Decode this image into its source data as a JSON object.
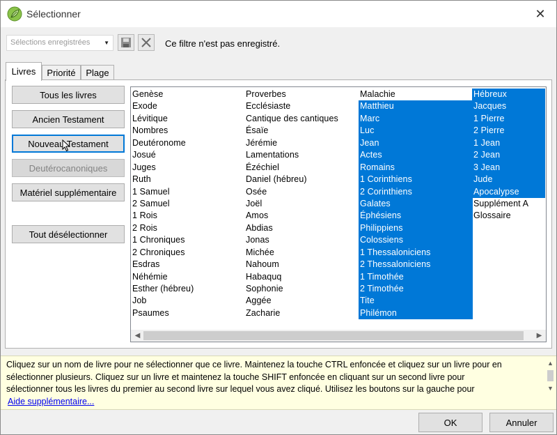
{
  "window": {
    "title": "Sélectionner"
  },
  "toolbar": {
    "saved_selections_placeholder": "Sélections enregistrées",
    "filter_status": "Ce filtre n'est pas enregistré."
  },
  "tabs": [
    {
      "label": "Livres",
      "active": true
    },
    {
      "label": "Priorité",
      "active": false
    },
    {
      "label": "Plage",
      "active": false
    }
  ],
  "side_buttons": {
    "all_books": "Tous les livres",
    "old_testament": "Ancien Testament",
    "new_testament": "Nouveau Testament",
    "deuterocanonical": "Deutérocanoniques",
    "supplementary": "Matériel supplémentaire",
    "deselect_all": "Tout désélectionner"
  },
  "books": {
    "col1": [
      "Genèse",
      "Exode",
      "Lévitique",
      "Nombres",
      "Deutéronome",
      "Josué",
      "Juges",
      "Ruth",
      "1 Samuel",
      "2 Samuel",
      "1 Rois",
      "2 Rois",
      "1 Chroniques",
      "2 Chroniques",
      "Esdras",
      "Néhémie",
      "Esther (hébreu)",
      "Job",
      "Psaumes"
    ],
    "col2": [
      "Proverbes",
      "Ecclésiaste",
      "Cantique des cantiques",
      "Ésaïe",
      "Jérémie",
      "Lamentations",
      "Ézéchiel",
      "Daniel (hébreu)",
      "Osée",
      "Joël",
      "Amos",
      "Abdias",
      "Jonas",
      "Michée",
      "Nahoum",
      "Habaquq",
      "Sophonie",
      "Aggée",
      "Zacharie"
    ],
    "col3": [
      "Malachie",
      "Matthieu",
      "Marc",
      "Luc",
      "Jean",
      "Actes",
      "Romains",
      "1 Corinthiens",
      "2 Corinthiens",
      "Galates",
      "Éphésiens",
      "Philippiens",
      "Colossiens",
      "1 Thessaloniciens",
      "2 Thessaloniciens",
      "1 Timothée",
      "2 Timothée",
      "Tite",
      "Philémon"
    ],
    "col4": [
      "Hébreux",
      "Jacques",
      "1 Pierre",
      "2 Pierre",
      "1 Jean",
      "2 Jean",
      "3 Jean",
      "Jude",
      "Apocalypse",
      "Supplément A",
      "Glossaire"
    ]
  },
  "help": {
    "line1": "Cliquez sur un nom de livre pour ne sélectionner que ce livre. Maintenez la touche CTRL enfoncée et cliquez sur un livre pour en",
    "line2": "sélectionner plusieurs. Cliquez sur un livre et maintenez la touche SHIFT enfoncée en cliquant sur un second livre pour",
    "line3": "sélectionner tous les livres du premier au second livre sur lequel vous avez cliqué. Utilisez les boutons sur la gauche pour",
    "link": "Aide supplémentaire..."
  },
  "dialog_buttons": {
    "ok": "OK",
    "cancel": "Annuler"
  },
  "colors": {
    "selection": "#0078d7",
    "help_background": "#ffffe1",
    "link": "#0000ee"
  }
}
